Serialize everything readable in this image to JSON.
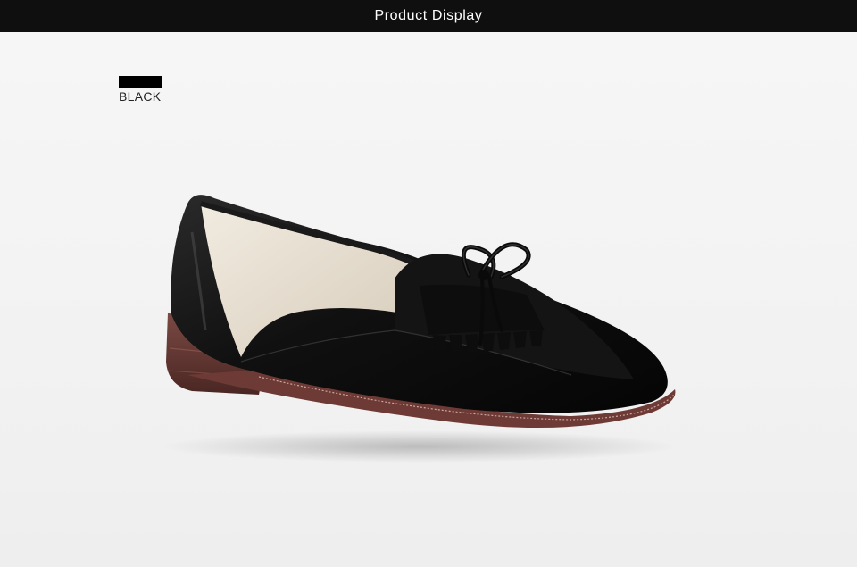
{
  "header": {
    "title": "Product Display"
  },
  "color_option": {
    "label": "BLACK",
    "swatch_color": "#000000"
  },
  "product": {
    "image_icon": "black-tassel-bow-loafer-image",
    "shoe_color": "#121212",
    "sole_color": "#6e3a36"
  }
}
